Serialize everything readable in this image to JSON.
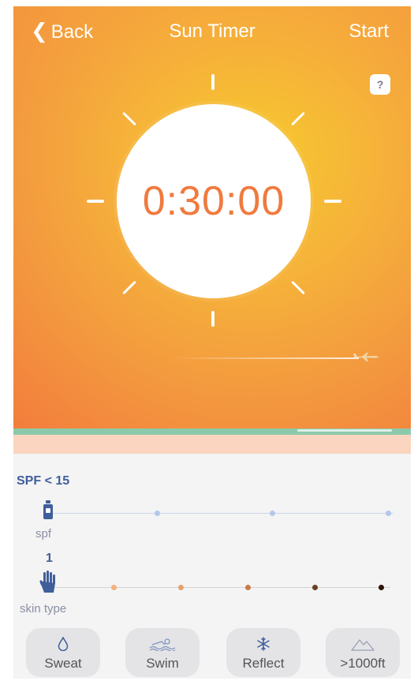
{
  "nav": {
    "back_label": "Back",
    "title": "Sun Timer",
    "start_label": "Start",
    "help_label": "?"
  },
  "timer": {
    "value": "0:30:00"
  },
  "spf": {
    "value_label": "SPF < 15",
    "caption": "spf",
    "selected_index": 0,
    "steps": 4
  },
  "skin": {
    "value_label": "1",
    "caption": "skin type",
    "selected_index": 0,
    "step_colors": [
      "#f4b07e",
      "#e9a06a",
      "#c97a45",
      "#6b4020",
      "#2e1408"
    ]
  },
  "options": [
    {
      "label": "Sweat",
      "icon": "droplet-icon"
    },
    {
      "label": "Swim",
      "icon": "swimmer-icon"
    },
    {
      "label": "Reflect",
      "icon": "snowflake-icon"
    },
    {
      "label": ">1000ft",
      "icon": "mountain-icon"
    }
  ],
  "colors": {
    "timer_text": "#f07a3f",
    "accent_blue": "#3f5e9a",
    "sea": "#8cc9ab",
    "sand": "#fbd5bf"
  }
}
